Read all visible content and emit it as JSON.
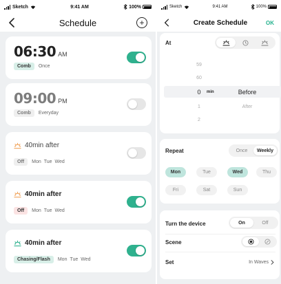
{
  "left": {
    "status": {
      "carrier": "Sketch",
      "time": "9:41 AM",
      "battery": "100%"
    },
    "nav": {
      "title": "Schedule"
    },
    "cards": [
      {
        "time": "06:30",
        "ampm": "AM",
        "mode": "Comb",
        "repeat": "Once",
        "on": true
      },
      {
        "time": "09:00",
        "ampm": "PM",
        "mode": "Comb",
        "repeat": "Everyday",
        "on": false
      },
      {
        "label": "40min after",
        "mode": "Off",
        "days": [
          "Mon",
          "Tue",
          "Wed"
        ],
        "on": false,
        "icon": "sunrise-icon"
      },
      {
        "label": "40min after",
        "mode": "Off",
        "days": [
          "Mon",
          "Tue",
          "Wed"
        ],
        "on": true,
        "icon": "sunrise-icon"
      },
      {
        "label": "40min after",
        "mode": "Chasing/Flash",
        "days": [
          "Mon",
          "Tue",
          "Wed"
        ],
        "on": true,
        "icon": "sunset-icon"
      }
    ]
  },
  "right": {
    "status": {
      "carrier": "Sketch",
      "time": "9:41 AM",
      "battery": "100%"
    },
    "nav": {
      "title": "Create Schedule",
      "ok": "OK"
    },
    "at": {
      "label": "At",
      "modes": [
        "sunrise-icon",
        "clock-icon",
        "sunset-icon"
      ],
      "selected_mode": 0,
      "picker": {
        "numbers": [
          "59",
          "60",
          "0",
          "1",
          "2"
        ],
        "unit": "min",
        "words": [
          "Before",
          "After"
        ]
      }
    },
    "repeat": {
      "label": "Repeat",
      "options": [
        "Once",
        "Weekly"
      ],
      "selected": "Weekly",
      "days": [
        {
          "label": "Mon",
          "selected": true
        },
        {
          "label": "Tue",
          "selected": false
        },
        {
          "label": "Wed",
          "selected": true
        },
        {
          "label": "Thu",
          "selected": false
        },
        {
          "label": "Fri",
          "selected": false
        },
        {
          "label": "Sat",
          "selected": false
        },
        {
          "label": "Sun",
          "selected": false
        }
      ]
    },
    "device": {
      "label": "Turn the device",
      "options": [
        "On",
        "Off"
      ],
      "selected": "On",
      "scene_label": "Scene",
      "set_label": "Set",
      "set_value": "In Waves"
    }
  }
}
